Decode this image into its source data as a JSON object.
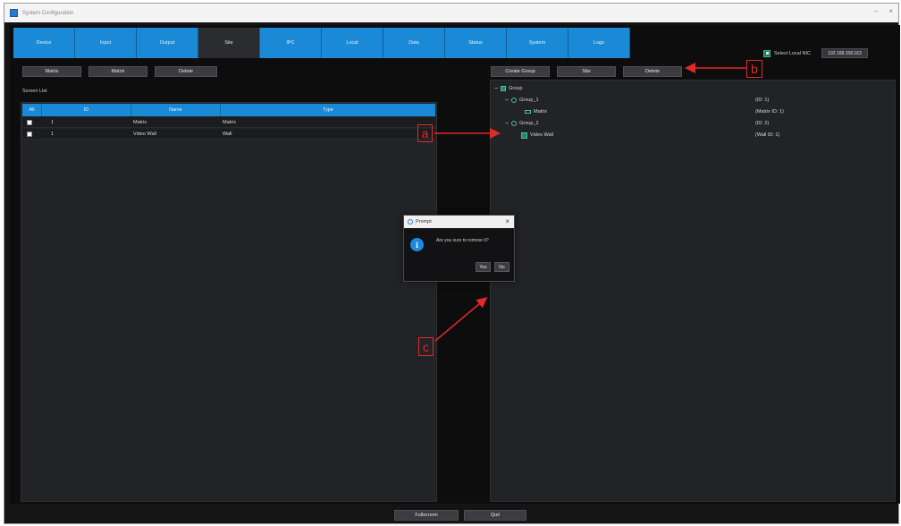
{
  "window": {
    "title": "System Configuration"
  },
  "tabs": [
    "Device",
    "Input",
    "Output",
    "Site",
    "IPC",
    "Local",
    "Data",
    "Status",
    "System",
    "Logs"
  ],
  "active_tab_index": 3,
  "local_nic": {
    "label": "Select Local NIC",
    "ip": "192.168.158.163"
  },
  "left_toolbar": {
    "matrix1": "Matrix",
    "matrix2": "Matrix",
    "delete": "Delete"
  },
  "screen_list": {
    "title": "Screen List",
    "columns": {
      "all": "All",
      "id": "ID",
      "name": "Name",
      "type": "Type"
    },
    "rows": [
      {
        "id": "1",
        "name": "Matrix",
        "type": "Matrix"
      },
      {
        "id": "1",
        "name": "Video Wall",
        "type": "Wall"
      }
    ]
  },
  "right_toolbar": {
    "create_group": "Create Group",
    "site": "Site",
    "delete": "Delete"
  },
  "tree": {
    "root": "Group",
    "group1": {
      "name": "Group_1",
      "info": "(ID: 1)"
    },
    "matrix": {
      "name": "Matrix",
      "info": "(Matrix ID: 1)"
    },
    "group2": {
      "name": "Group_2",
      "info": "(ID: 2)"
    },
    "wall": {
      "name": "Video Wall",
      "info": "(Wall ID: 1)"
    }
  },
  "dialog": {
    "title": "Prompt",
    "message": "Are you sure to remove it?",
    "yes": "Yes",
    "no": "No"
  },
  "bottom": {
    "fullscreen": "Fullscreen",
    "quit": "Quit"
  },
  "callouts": {
    "a": "a",
    "b": "b",
    "c": "c"
  },
  "colors": {
    "tab_blue": "#1a89d6",
    "annotation_red": "#e02a2a",
    "panel": "#222326"
  }
}
